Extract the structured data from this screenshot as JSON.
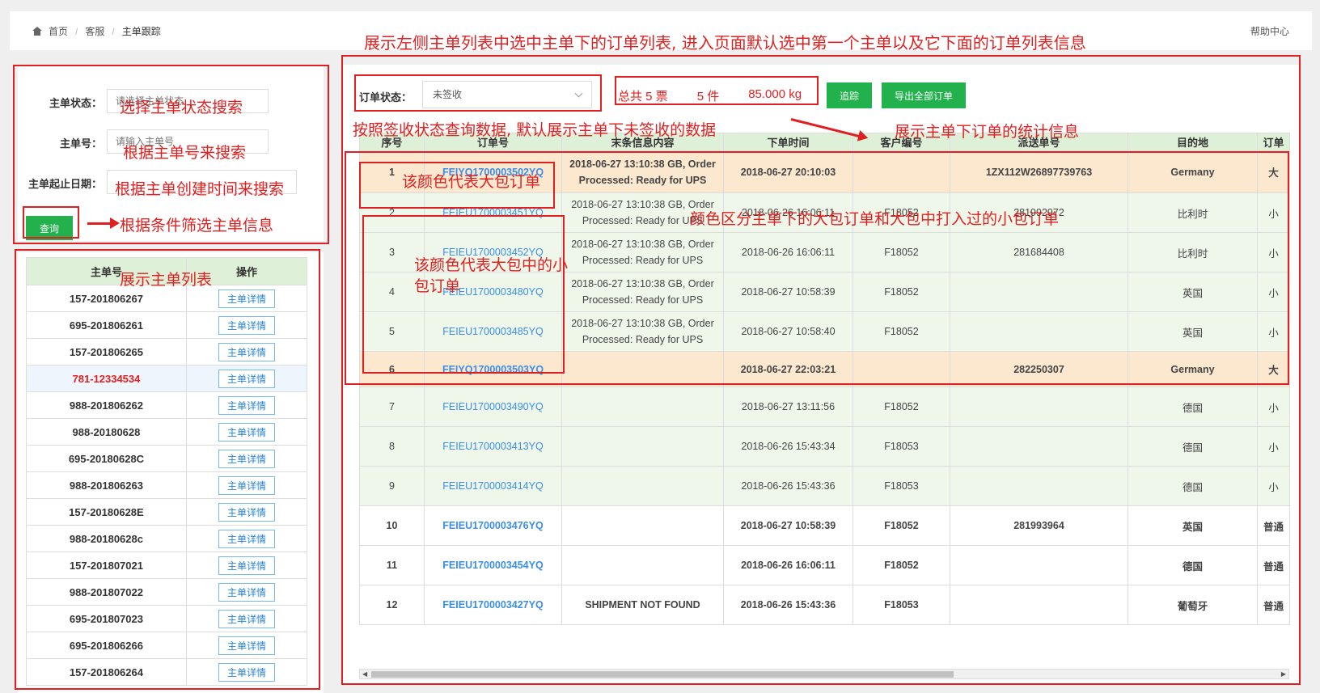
{
  "breadcrumb": {
    "home": "首页",
    "parent": "客服",
    "current": "主单跟踪",
    "help": "帮助中心"
  },
  "search": {
    "status_label": "主单状态：",
    "status_placeholder": "请选择主单状态",
    "number_label": "主单号：",
    "number_placeholder": "请输入主单号",
    "date_label": "主单起止日期：",
    "date_placeholder": "",
    "query_button": "查询"
  },
  "master_list": {
    "headers": [
      "主单号",
      "操作"
    ],
    "detail_label": "主单详情",
    "rows": [
      {
        "no": "157-201806267"
      },
      {
        "no": "695-201806261"
      },
      {
        "no": "157-201806265"
      },
      {
        "no": "781-12334534",
        "selected": true
      },
      {
        "no": "988-201806262"
      },
      {
        "no": "988-20180628"
      },
      {
        "no": "695-20180628C"
      },
      {
        "no": "988-201806263"
      },
      {
        "no": "157-20180628E"
      },
      {
        "no": "988-20180628c"
      },
      {
        "no": "157-201807021"
      },
      {
        "no": "988-201807022"
      },
      {
        "no": "695-201807023"
      },
      {
        "no": "695-201806266"
      },
      {
        "no": "157-201806264"
      }
    ]
  },
  "orders": {
    "filter_label": "订单状态：",
    "filter_value": "未签收",
    "stats": {
      "tickets": "总共 5 票",
      "pieces": "5 件",
      "weight": "85.000 kg"
    },
    "track_button": "追踪",
    "export_button": "导出全部订单",
    "headers": [
      "序号",
      "订单号",
      "末条信息内容",
      "下单时间",
      "客户编号",
      "派送单号",
      "目的地",
      "订单"
    ],
    "rows": [
      {
        "type": "big",
        "seq": "1",
        "order": "FEIYQ1700003502YQ",
        "info": "2018-06-27 13:10:38 GB, Order Processed: Ready for UPS",
        "time": "2018-06-27 20:10:03",
        "cust": "",
        "delivery": "1ZX112W26897739763",
        "dest": "Germany",
        "kind": "大"
      },
      {
        "type": "small",
        "seq": "2",
        "order": "FEIEU1700003451YQ",
        "info": "2018-06-27 13:10:38 GB, Order Processed: Ready for UPS",
        "time": "2018-06-26 16:06:11",
        "cust": "F18052",
        "delivery": "281992972",
        "dest": "比利时",
        "kind": "小"
      },
      {
        "type": "small",
        "seq": "3",
        "order": "FEIEU1700003452YQ",
        "info": "2018-06-27 13:10:38 GB, Order Processed: Ready for UPS",
        "time": "2018-06-26 16:06:11",
        "cust": "F18052",
        "delivery": "281684408",
        "dest": "比利时",
        "kind": "小"
      },
      {
        "type": "small",
        "seq": "4",
        "order": "FEIEU1700003480YQ",
        "info": "2018-06-27 13:10:38 GB, Order Processed: Ready for UPS",
        "time": "2018-06-27 10:58:39",
        "cust": "F18052",
        "delivery": "",
        "dest": "英国",
        "kind": "小"
      },
      {
        "type": "small",
        "seq": "5",
        "order": "FEIEU1700003485YQ",
        "info": "2018-06-27 13:10:38 GB, Order Processed: Ready for UPS",
        "time": "2018-06-27 10:58:40",
        "cust": "F18052",
        "delivery": "",
        "dest": "英国",
        "kind": "小"
      },
      {
        "type": "big",
        "seq": "6",
        "order": "FEIYQ1700003503YQ",
        "info": "",
        "time": "2018-06-27 22:03:21",
        "cust": "",
        "delivery": "282250307",
        "dest": "Germany",
        "kind": "大"
      },
      {
        "type": "small",
        "seq": "7",
        "order": "FEIEU1700003490YQ",
        "info": "",
        "time": "2018-06-27 13:11:56",
        "cust": "F18052",
        "delivery": "",
        "dest": "德国",
        "kind": "小"
      },
      {
        "type": "small",
        "seq": "8",
        "order": "FEIEU1700003413YQ",
        "info": "",
        "time": "2018-06-26 15:43:34",
        "cust": "F18053",
        "delivery": "",
        "dest": "德国",
        "kind": "小"
      },
      {
        "type": "small",
        "seq": "9",
        "order": "FEIEU1700003414YQ",
        "info": "",
        "time": "2018-06-26 15:43:36",
        "cust": "F18053",
        "delivery": "",
        "dest": "德国",
        "kind": "小"
      },
      {
        "type": "normal",
        "seq": "10",
        "order": "FEIEU1700003476YQ",
        "info": "",
        "time": "2018-06-27 10:58:39",
        "cust": "F18052",
        "delivery": "281993964",
        "dest": "英国",
        "kind": "普通"
      },
      {
        "type": "normal",
        "seq": "11",
        "order": "FEIEU1700003454YQ",
        "info": "",
        "time": "2018-06-26 16:06:11",
        "cust": "F18052",
        "delivery": "",
        "dest": "德国",
        "kind": "普通"
      },
      {
        "type": "normal",
        "seq": "12",
        "order": "FEIEU1700003427YQ",
        "info": "SHIPMENT NOT FOUND",
        "time": "2018-06-26 15:43:36",
        "cust": "F18053",
        "delivery": "",
        "dest": "葡萄牙",
        "kind": "普通"
      }
    ]
  },
  "annotations": {
    "top": "展示左侧主单列表中选中主单下的订单列表, 进入页面默认选中第一个主单以及它下面的订单列表信息",
    "status": "选择主单状态搜索",
    "number": "根据主单号来搜索",
    "date": "根据主单创建时间来搜索",
    "query": "根据条件筛选主单信息",
    "list": "展示主单列表",
    "filter": "按照签收状态查询数据, 默认展示主单下未签收的数据",
    "stats": "展示主单下订单的统计信息",
    "big": "该颜色代表大包订单",
    "small": "该颜色代表大包中的小包订单",
    "color": "颜色区分主单下的大包订单和大包中打入过的小包订单"
  },
  "colors": {
    "primary": "#22b14c",
    "header_bg": "#dff0d8",
    "big_row": "#fbe8cf",
    "small_row": "#eef7ea",
    "link": "#3a8ee6",
    "annotation": "#e02020"
  }
}
